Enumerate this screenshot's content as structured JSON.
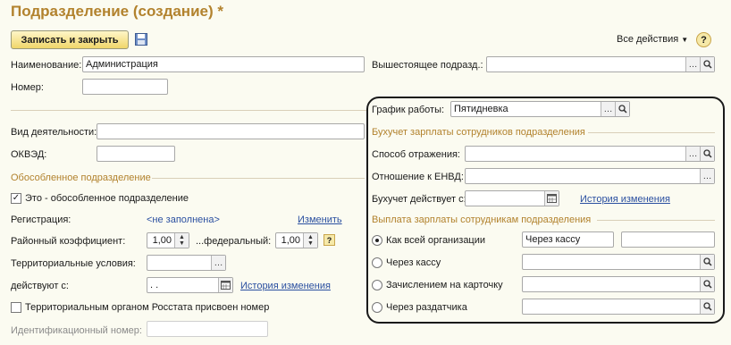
{
  "header": {
    "title": "Подразделение (создание) *",
    "save_close_label": "Записать и закрыть",
    "all_actions_label": "Все действия",
    "help_label": "?"
  },
  "left": {
    "name_label": "Наименование:",
    "name_value": "Администрация",
    "number_label": "Номер:",
    "number_value": "",
    "activity_label": "Вид деятельности:",
    "okved_label": "ОКВЭД:",
    "separate_section": "Обособленное подразделение",
    "is_separate_label": "Это - обособленное подразделение",
    "is_separate_checked": true,
    "registration_label": "Регистрация:",
    "registration_value": "<не заполнена>",
    "registration_change_link": "Изменить",
    "district_coef_label": "Районный коэффициент:",
    "district_coef_value": "1,00",
    "federal_label": "...федеральный:",
    "federal_value": "1,00",
    "territorial_label": "Территориальные условия:",
    "effective_label": "действуют с:",
    "effective_date": " .  .",
    "history_link": "История изменения",
    "rosstat_label": "Территориальным органом Росстата присвоен номер",
    "rosstat_checked": false,
    "id_number_label": "Идентификационный номер:"
  },
  "right": {
    "parent_label": "Вышестоящее подразд.:",
    "parent_value": "",
    "schedule_label": "График работы:",
    "schedule_value": "Пятидневка",
    "accounting_section": "Бухучет зарплаты сотрудников подразделения",
    "reflection_label": "Способ отражения:",
    "envd_label": "Отношение к ЕНВД:",
    "acc_effective_label": "Бухучет действует с:",
    "acc_history_link": "История изменения",
    "payment_section": "Выплата зарплаты сотрудникам подразделения",
    "payment_options": [
      {
        "label": "Как всей организации",
        "selected": true
      },
      {
        "label": "Через кассу",
        "selected": false
      },
      {
        "label": "Зачислением на карточку",
        "selected": false
      },
      {
        "label": "Через раздатчика",
        "selected": false
      }
    ],
    "org_payment_value": "Через кассу"
  },
  "colors": {
    "title_color": "#b2822d",
    "link_color": "#2a4fa0",
    "background": "#fbfbf1"
  }
}
